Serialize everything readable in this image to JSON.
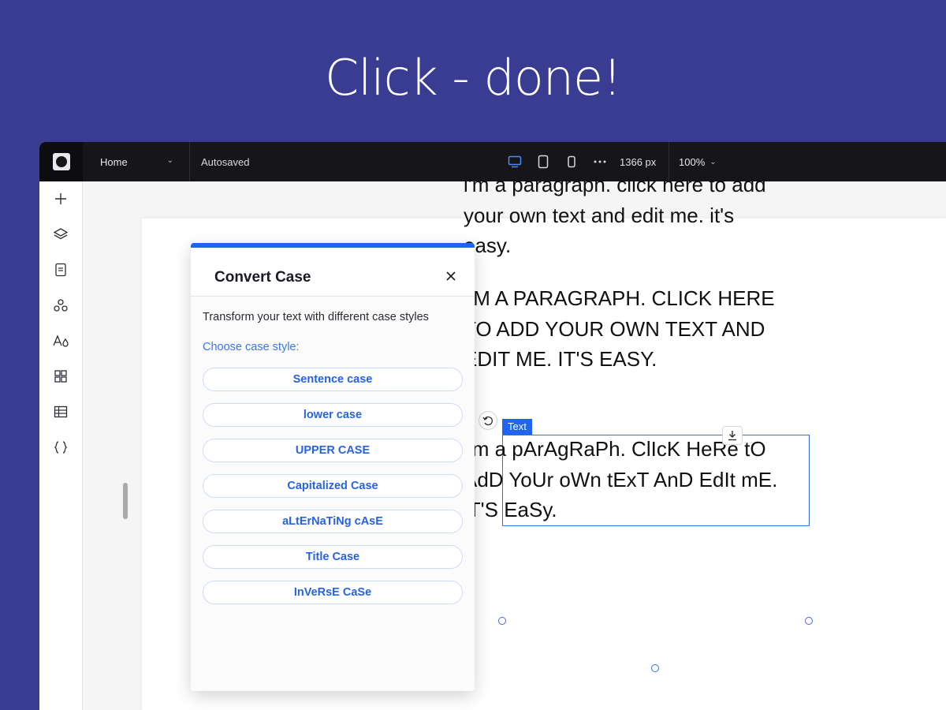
{
  "hero": {
    "title": "Click - done!"
  },
  "topbar": {
    "page_name": "Home",
    "status": "Autosaved",
    "width_label": "1366 px",
    "zoom_label": "100%",
    "icons": [
      "desktop-icon",
      "tablet-icon",
      "mobile-icon",
      "more-icon"
    ]
  },
  "sidebar": {
    "items": [
      "add-icon",
      "layers-icon",
      "pages-icon",
      "apps-icon",
      "theme-icon",
      "widgets-icon",
      "cms-icon",
      "code-icon"
    ]
  },
  "canvas": {
    "paragraphs": [
      "i'm a paragraph. click here to add your own text and edit me. it's easy.",
      "I'M A PARAGRAPH. CLICK HERE TO ADD YOUR OWN TEXT AND EDIT ME. IT'S EASY.",
      "i'm a pArAgRaPh. ClIcK HeRe tO AdD YoUr oWn tExT AnD EdIt mE. iT'S EaSy."
    ],
    "selection_tag": "Text"
  },
  "panel": {
    "title": "Convert Case",
    "description": "Transform your text with different case styles",
    "choose_label": "Choose case style:",
    "options": [
      "Sentence case",
      "lower case",
      "UPPER CASE",
      "Capitalized Case",
      "aLtErNaTiNg cAsE",
      "Title Case",
      "InVeRsE CaSe"
    ]
  },
  "colors": {
    "background": "#3a3c92",
    "accent": "#1f65f0",
    "topbar": "#15151a"
  }
}
